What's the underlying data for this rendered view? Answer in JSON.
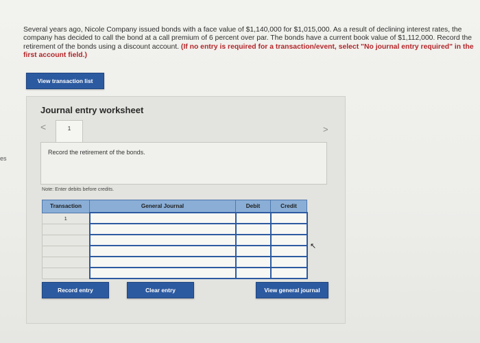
{
  "edge_fragment": "es",
  "question": {
    "text": "Several years ago, Nicole Company issued bonds with a face value of $1,140,000 for $1,015,000. As a result of declining interest rates, the company has decided to call the bond at a call premium of 6 percent over par. The bonds have a current book value of $1,112,000. Record the retirement of the bonds using a discount account.",
    "note": " (If no entry is required for a transaction/event, select \"No journal entry required\" in the first account field.)"
  },
  "buttons": {
    "view_transaction_list": "View transaction list",
    "record_entry": "Record entry",
    "clear_entry": "Clear entry",
    "view_general_journal": "View general journal"
  },
  "worksheet": {
    "title": "Journal entry worksheet",
    "prev_icon": "chevron-left-icon",
    "next_icon": "chevron-right-icon",
    "prev_glyph": "<",
    "next_glyph": ">",
    "tab_label": "1",
    "description": "Record the retirement of the bonds.",
    "note": "Note: Enter debits before credits."
  },
  "table": {
    "headers": {
      "transaction": "Transaction",
      "general_journal": "General Journal",
      "debit": "Debit",
      "credit": "Credit"
    },
    "rows": [
      {
        "transaction": "1",
        "general_journal": "",
        "debit": "",
        "credit": ""
      },
      {
        "transaction": "",
        "general_journal": "",
        "debit": "",
        "credit": ""
      },
      {
        "transaction": "",
        "general_journal": "",
        "debit": "",
        "credit": ""
      },
      {
        "transaction": "",
        "general_journal": "",
        "debit": "",
        "credit": ""
      },
      {
        "transaction": "",
        "general_journal": "",
        "debit": "",
        "credit": ""
      },
      {
        "transaction": "",
        "general_journal": "",
        "debit": "",
        "credit": ""
      }
    ]
  },
  "colors": {
    "button": "#2c5aa0",
    "table_header": "#8aaed6",
    "note_red": "#b3262a"
  }
}
